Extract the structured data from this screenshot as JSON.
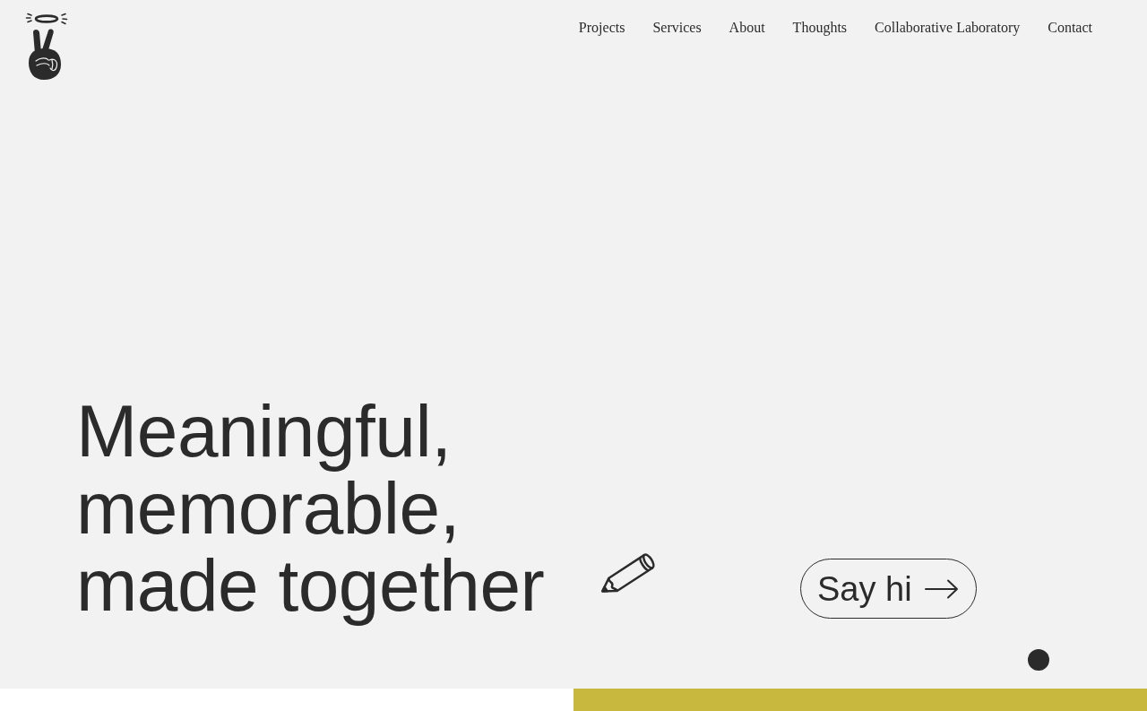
{
  "header": {
    "nav": [
      {
        "label": "Projects"
      },
      {
        "label": "Services"
      },
      {
        "label": "About"
      },
      {
        "label": "Thoughts"
      },
      {
        "label": "Collaborative Laboratory"
      },
      {
        "label": "Contact"
      }
    ]
  },
  "hero": {
    "headline": [
      "Meaningful,",
      "memorable,",
      "made together"
    ],
    "cta": {
      "label": "Say hi"
    }
  }
}
